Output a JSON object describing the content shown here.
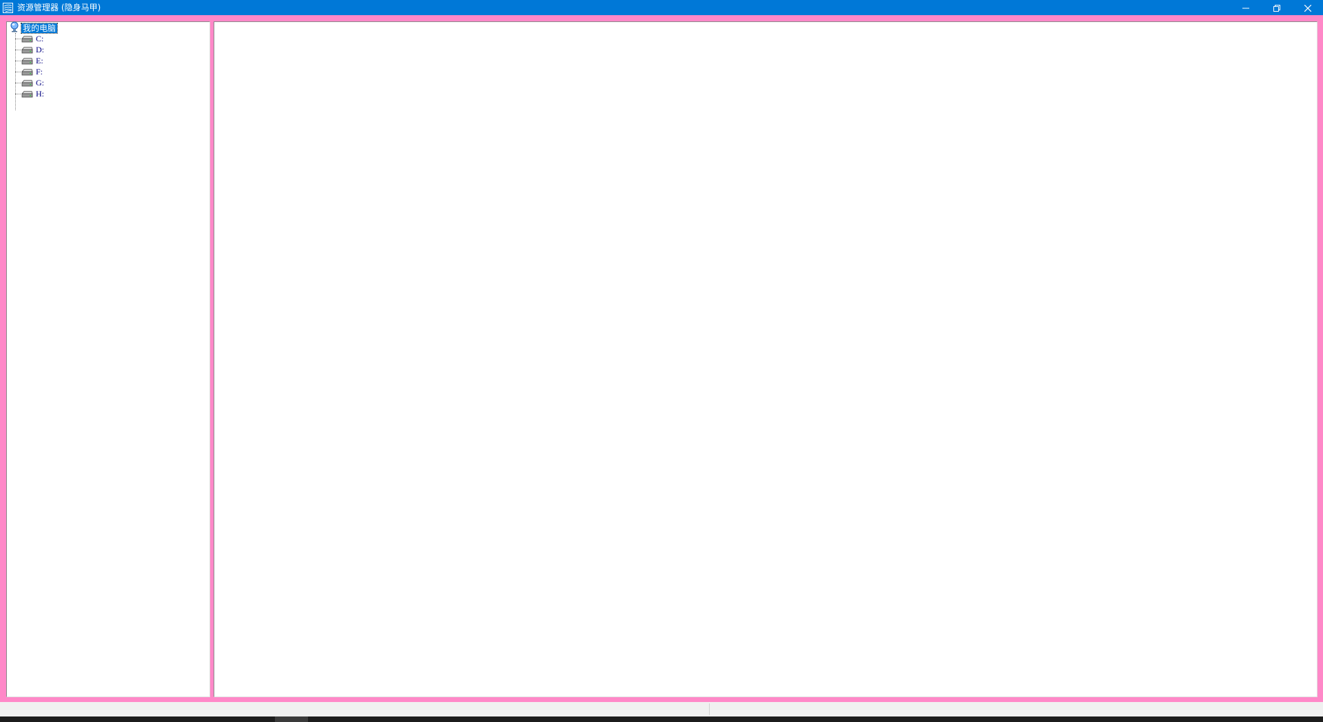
{
  "window": {
    "title": "资源管理器 (隐身马甲)",
    "icons": {
      "app": "app-logo-icon",
      "minimize": "minimize-icon",
      "maximize": "restore-icon",
      "close": "close-icon"
    },
    "colors": {
      "titlebar": "#0078d7",
      "frame": "#ff88c8",
      "selection": "#0078d7",
      "drive_text": "#000080"
    }
  },
  "tree": {
    "root": {
      "label": "我的电脑",
      "icon": "computer-icon"
    },
    "drives": [
      {
        "label": "C:",
        "icon": "drive-icon"
      },
      {
        "label": "D:",
        "icon": "drive-icon"
      },
      {
        "label": "E:",
        "icon": "drive-icon"
      },
      {
        "label": "F:",
        "icon": "drive-icon"
      },
      {
        "label": "G:",
        "icon": "drive-icon"
      },
      {
        "label": "H:",
        "icon": "drive-icon"
      }
    ]
  }
}
